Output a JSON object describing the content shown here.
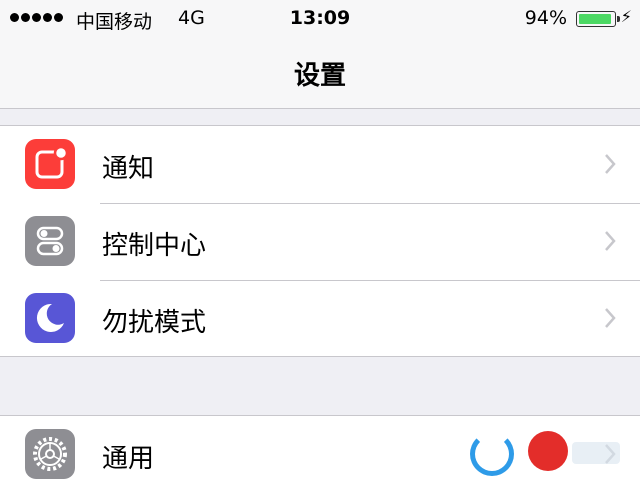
{
  "status_bar": {
    "carrier": "中国移动",
    "network": "4G",
    "time": "13:09",
    "battery_percent": "94%",
    "battery_level": 0.94,
    "battery_color": "#4cd964",
    "charging_icon": "⚡"
  },
  "nav": {
    "title": "设置"
  },
  "groups": [
    {
      "items": [
        {
          "label": "通知",
          "icon": "notifications-icon",
          "icon_color": "#fc3d39"
        },
        {
          "label": "控制中心",
          "icon": "control-center-icon",
          "icon_color": "#8e8e93"
        },
        {
          "label": "勿扰模式",
          "icon": "do-not-disturb-moon-icon",
          "icon_color": "#5856d6"
        }
      ]
    },
    {
      "items": [
        {
          "label": "通用",
          "icon": "general-gear-icon",
          "icon_color": "#8e8e93"
        }
      ]
    }
  ]
}
